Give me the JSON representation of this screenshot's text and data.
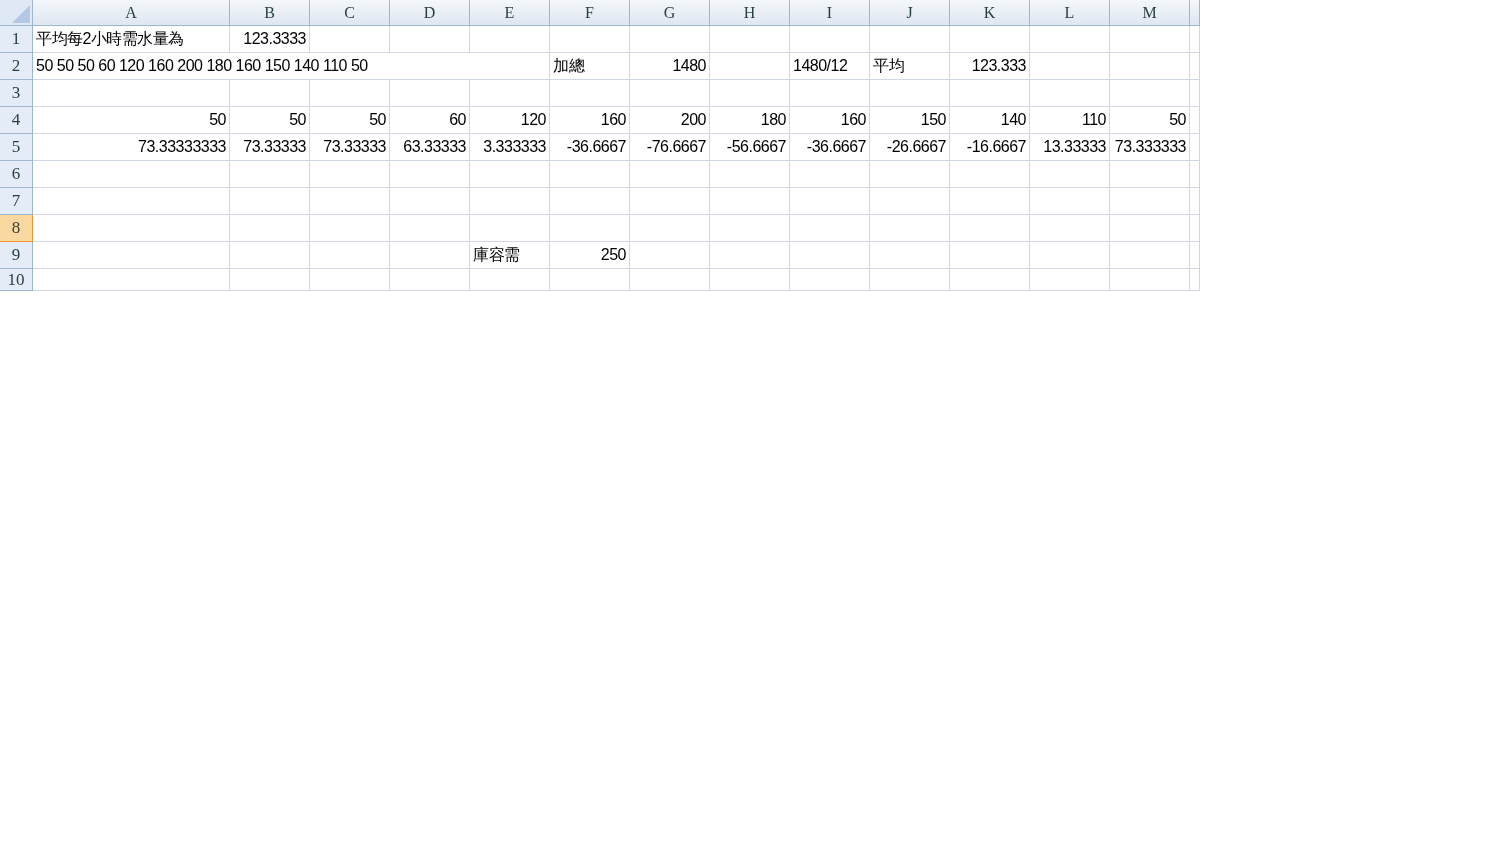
{
  "columns": [
    "A",
    "B",
    "C",
    "D",
    "E",
    "F",
    "G",
    "H",
    "I",
    "J",
    "K",
    "L",
    "M"
  ],
  "rows": [
    {
      "header": "1",
      "selected": false,
      "cells": [
        {
          "kind": "text",
          "text": "平均每2小時需水量為"
        },
        {
          "kind": "number",
          "text": "123.3333"
        },
        {
          "kind": "empty"
        },
        {
          "kind": "empty"
        },
        {
          "kind": "empty"
        },
        {
          "kind": "empty"
        },
        {
          "kind": "empty"
        },
        {
          "kind": "empty"
        },
        {
          "kind": "empty"
        },
        {
          "kind": "empty"
        },
        {
          "kind": "empty"
        },
        {
          "kind": "empty"
        },
        {
          "kind": "empty"
        }
      ]
    },
    {
      "header": "2",
      "selected": false,
      "cells": [
        {
          "kind": "text",
          "text": "50 50 50 60 120 160 200 180 160 150 140 110 50"
        },
        {
          "kind": "empty"
        },
        {
          "kind": "empty"
        },
        {
          "kind": "empty"
        },
        {
          "kind": "empty"
        },
        {
          "kind": "text",
          "text": "加總"
        },
        {
          "kind": "number",
          "text": "1480"
        },
        {
          "kind": "empty"
        },
        {
          "kind": "text",
          "text": "1480/12"
        },
        {
          "kind": "text",
          "text": "平均"
        },
        {
          "kind": "number",
          "text": "123.333"
        },
        {
          "kind": "empty"
        },
        {
          "kind": "empty"
        }
      ]
    },
    {
      "header": "3",
      "selected": false,
      "cells": []
    },
    {
      "header": "4",
      "selected": false,
      "cells": [
        {
          "kind": "number",
          "text": "50"
        },
        {
          "kind": "number",
          "text": "50"
        },
        {
          "kind": "number",
          "text": "50"
        },
        {
          "kind": "number",
          "text": "60"
        },
        {
          "kind": "number",
          "text": "120"
        },
        {
          "kind": "number",
          "text": "160"
        },
        {
          "kind": "number",
          "text": "200"
        },
        {
          "kind": "number",
          "text": "180"
        },
        {
          "kind": "number",
          "text": "160"
        },
        {
          "kind": "number",
          "text": "150"
        },
        {
          "kind": "number",
          "text": "140"
        },
        {
          "kind": "number",
          "text": "110"
        },
        {
          "kind": "number",
          "text": "50"
        }
      ]
    },
    {
      "header": "5",
      "selected": false,
      "cells": [
        {
          "kind": "number",
          "text": "73.33333333"
        },
        {
          "kind": "number",
          "text": "73.33333"
        },
        {
          "kind": "number",
          "text": "73.33333"
        },
        {
          "kind": "number",
          "text": "63.33333"
        },
        {
          "kind": "number",
          "text": "3.333333"
        },
        {
          "kind": "number",
          "text": "-36.6667"
        },
        {
          "kind": "number",
          "text": "-76.6667"
        },
        {
          "kind": "number",
          "text": "-56.6667"
        },
        {
          "kind": "number",
          "text": "-36.6667"
        },
        {
          "kind": "number",
          "text": "-26.6667"
        },
        {
          "kind": "number",
          "text": "-16.6667"
        },
        {
          "kind": "number",
          "text": "13.33333"
        },
        {
          "kind": "number",
          "text": "73.333333"
        }
      ]
    },
    {
      "header": "6",
      "selected": false,
      "cells": []
    },
    {
      "header": "7",
      "selected": false,
      "cells": []
    },
    {
      "header": "8",
      "selected": true,
      "cells": []
    },
    {
      "header": "9",
      "selected": false,
      "cells": [
        {
          "kind": "empty"
        },
        {
          "kind": "empty"
        },
        {
          "kind": "empty"
        },
        {
          "kind": "empty"
        },
        {
          "kind": "text",
          "text": "庫容需"
        },
        {
          "kind": "number",
          "text": "250"
        },
        {
          "kind": "empty"
        },
        {
          "kind": "empty"
        },
        {
          "kind": "empty"
        },
        {
          "kind": "empty"
        },
        {
          "kind": "empty"
        },
        {
          "kind": "empty"
        },
        {
          "kind": "empty"
        }
      ]
    },
    {
      "header": "10",
      "selected": false,
      "cells": []
    }
  ]
}
